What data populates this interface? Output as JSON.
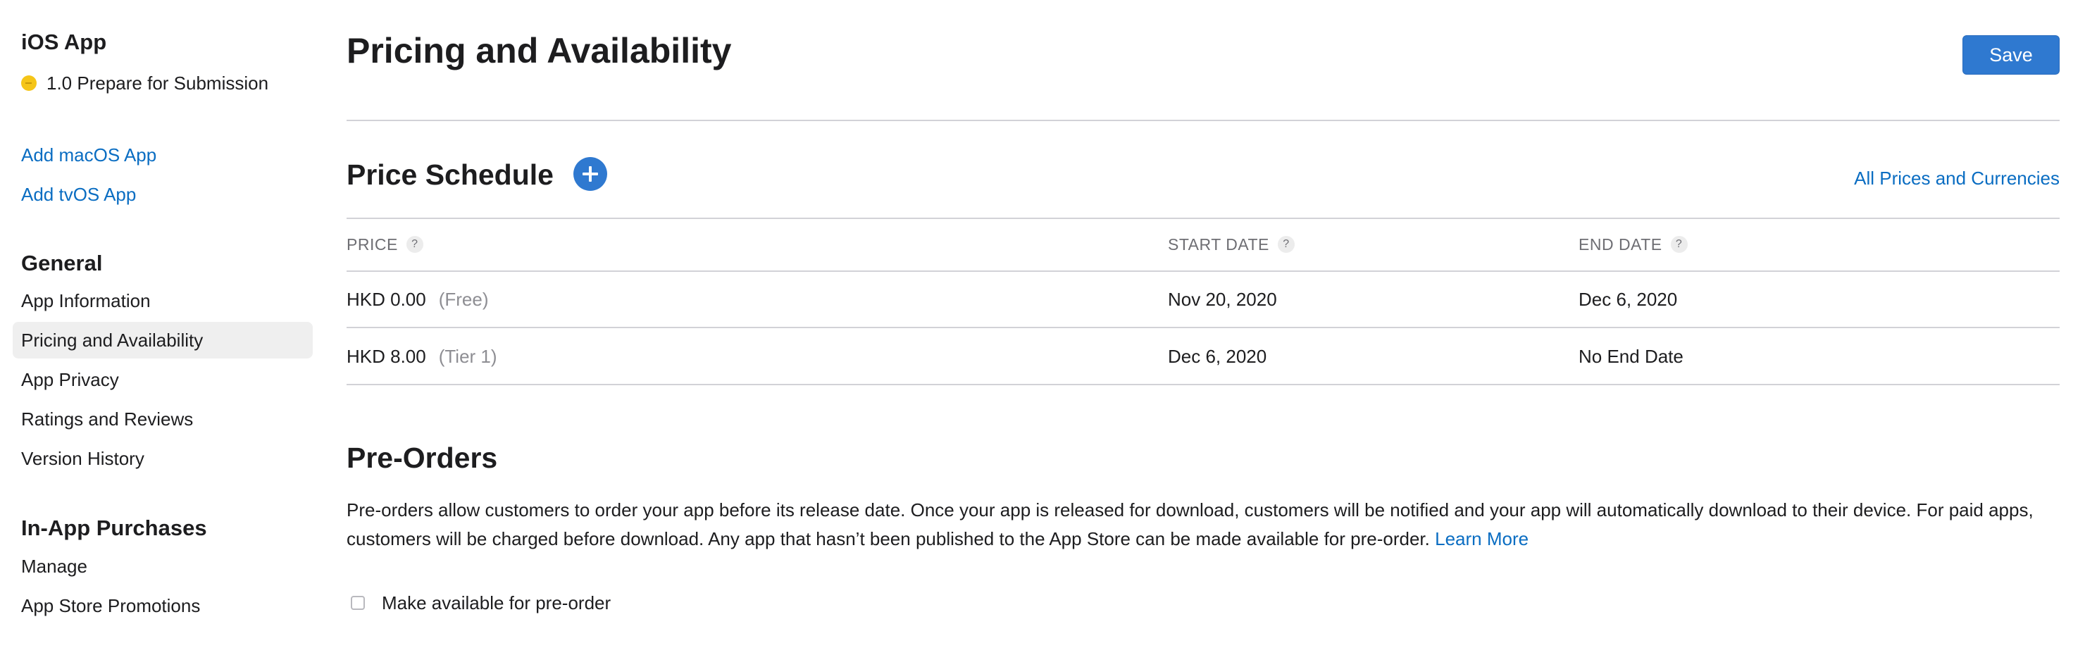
{
  "sidebar": {
    "app_title": "iOS App",
    "version_status": "1.0 Prepare for Submission",
    "status_color": "#f5c518",
    "add_links": [
      "Add macOS App",
      "Add tvOS App"
    ],
    "general": {
      "heading": "General",
      "items": [
        "App Information",
        "Pricing and Availability",
        "App Privacy",
        "Ratings and Reviews",
        "Version History"
      ],
      "active_item": "Pricing and Availability"
    },
    "in_app": {
      "heading": "In-App Purchases",
      "items": [
        "Manage",
        "App Store Promotions"
      ]
    }
  },
  "header": {
    "title": "Pricing and Availability",
    "save_label": "Save"
  },
  "price_schedule": {
    "title": "Price Schedule",
    "add_icon": "plus-circle-icon",
    "all_prices_link": "All Prices and Currencies",
    "columns": [
      "PRICE",
      "START DATE",
      "END DATE"
    ],
    "help_glyph": "?",
    "rows": [
      {
        "price": "HKD 0.00",
        "tier": "(Free)",
        "start": "Nov 20, 2020",
        "end": "Dec 6, 2020"
      },
      {
        "price": "HKD 8.00",
        "tier": "(Tier 1)",
        "start": "Dec 6, 2020",
        "end": "No End Date"
      }
    ]
  },
  "pre_orders": {
    "title": "Pre-Orders",
    "description": "Pre-orders allow customers to order your app before its release date. Once your app is released for download, customers will be notified and your app will automatically download to their device. For paid apps, customers will be charged before download. Any app that hasn’t been published to the App Store can be made available for pre-order.",
    "learn_more": "Learn More",
    "checkbox_label": "Make available for pre-order",
    "checkbox_checked": false
  },
  "colors": {
    "accent": "#2f79d0",
    "link": "#0a6dc2",
    "active_item_bg": "#efefef",
    "divider": "#d2d2d7"
  }
}
